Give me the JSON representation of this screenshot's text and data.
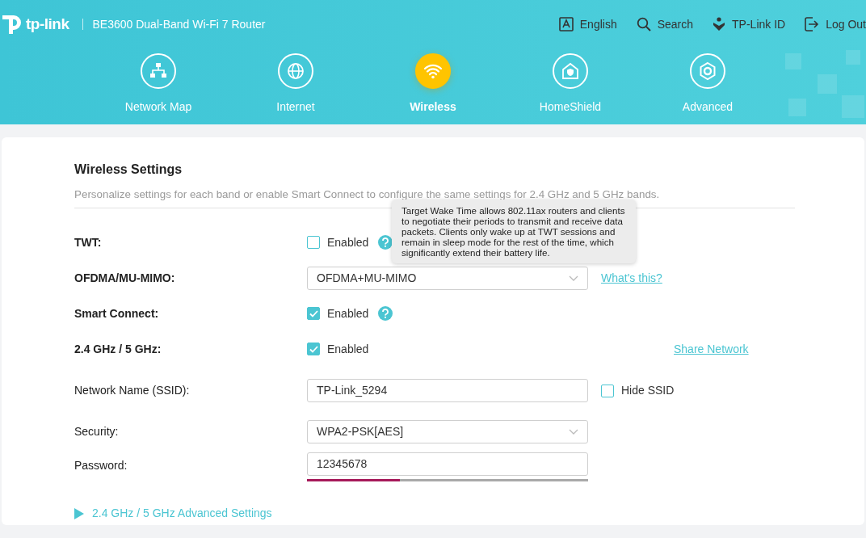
{
  "header": {
    "logo": "tp-link",
    "model": "BE3600 Dual-Band Wi-Fi 7 Router",
    "top_links": [
      {
        "kind": "language",
        "label": "English"
      },
      {
        "kind": "search",
        "label": "Search"
      },
      {
        "kind": "account",
        "label": "TP-Link ID"
      },
      {
        "kind": "logout",
        "label": "Log Out"
      }
    ],
    "nav": [
      {
        "kind": "network",
        "label": "Network Map",
        "selected": false
      },
      {
        "kind": "globe",
        "label": "Internet",
        "selected": false
      },
      {
        "kind": "wifi",
        "label": "Wireless",
        "selected": true
      },
      {
        "kind": "shield",
        "label": "HomeShield",
        "selected": false
      },
      {
        "kind": "gear",
        "label": "Advanced",
        "selected": false
      }
    ]
  },
  "section": {
    "title": "Wireless Settings",
    "description": "Personalize settings for each band or enable Smart Connect to configure the same settings for 2.4 GHz and 5 GHz bands.",
    "rows": [
      {
        "kind": "checkbox",
        "label": "TWT:",
        "bold": true,
        "option": "Enabled",
        "checked": false,
        "help": true
      },
      {
        "kind": "select",
        "label": "OFDMA/MU-MIMO:",
        "bold": true,
        "value": "OFDMA+MU-MIMO",
        "link": "What's this?"
      },
      {
        "kind": "checkbox",
        "label": "Smart Connect:",
        "bold": true,
        "option": "Enabled",
        "checked": true,
        "help": true
      },
      {
        "kind": "checkbox",
        "label": "2.4 GHz / 5 GHz:",
        "bold": true,
        "option": "Enabled",
        "checked": true,
        "help": false,
        "link": "Share Network"
      },
      {
        "kind": "input",
        "label": "Network Name (SSID):",
        "bold": false,
        "value": "TP-Link_5294",
        "side_option": "Hide SSID",
        "side_checked": false
      },
      {
        "kind": "select",
        "label": "Security:",
        "bold": false,
        "value": "WPA2-PSK[AES]"
      },
      {
        "kind": "password",
        "label": "Password:",
        "bold": false,
        "value": "12345678",
        "level": 0.33
      }
    ],
    "advanced": "2.4 GHz / 5 GHz Advanced Settings",
    "tooltip": "Target Wake Time allows 802.11ax routers and clients to negotiate their periods to transmit and receive data packets. Clients only wake up at TWT sessions and remain in sleep mode for the rest of the time, which significantly extend their battery life."
  }
}
